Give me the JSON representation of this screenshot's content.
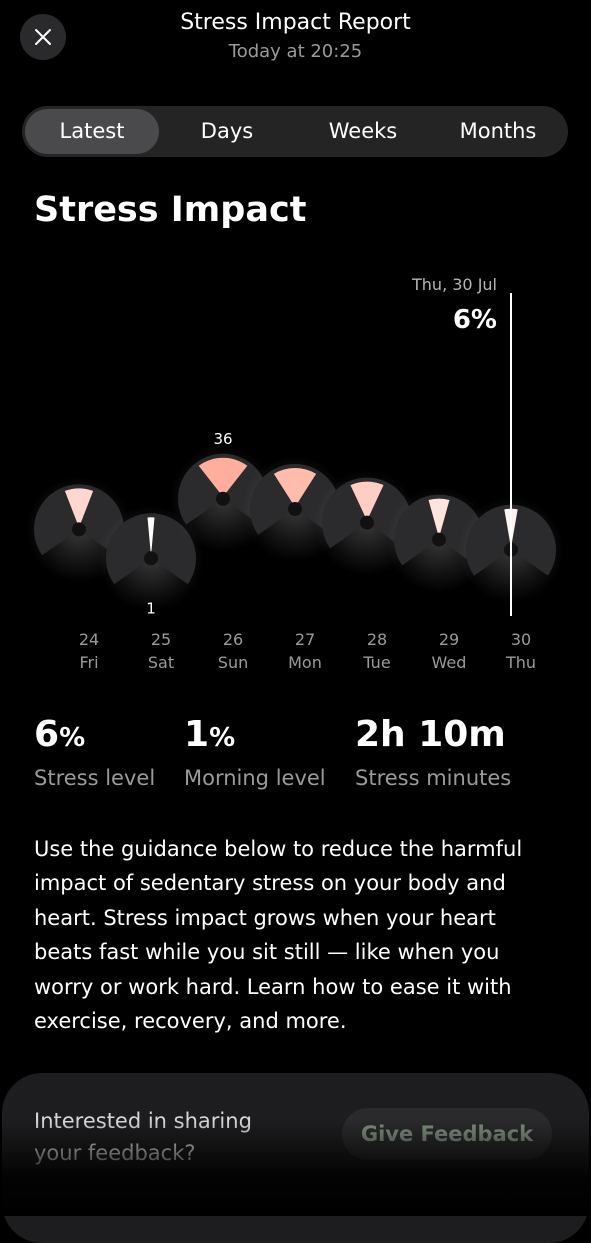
{
  "header": {
    "close_icon": "close-icon",
    "title": "Stress Impact Report",
    "subtitle": "Today at 20:25"
  },
  "tabs": [
    {
      "label": "Latest",
      "active": true
    },
    {
      "label": "Days",
      "active": false
    },
    {
      "label": "Weeks",
      "active": false
    },
    {
      "label": "Months",
      "active": false
    }
  ],
  "section_title": "Stress Impact",
  "chart_data": {
    "type": "dial",
    "selected": {
      "date": "Thu, 30 Jul",
      "value": "6%"
    },
    "days": [
      {
        "date": "24",
        "weekday": "Fri",
        "value": 18,
        "label": ""
      },
      {
        "date": "25",
        "weekday": "Sat",
        "value": 1,
        "label": "1"
      },
      {
        "date": "26",
        "weekday": "Sun",
        "value": 36,
        "label": "36"
      },
      {
        "date": "27",
        "weekday": "Mon",
        "value": 30,
        "label": ""
      },
      {
        "date": "28",
        "weekday": "Tue",
        "value": 22,
        "label": ""
      },
      {
        "date": "29",
        "weekday": "Wed",
        "value": 12,
        "label": ""
      },
      {
        "date": "30",
        "weekday": "Thu",
        "value": 6,
        "label": ""
      }
    ],
    "colors": {
      "low": "#ffffff",
      "high": "#f2a592"
    }
  },
  "stats": [
    {
      "value": "6",
      "unit": "%",
      "label": "Stress level"
    },
    {
      "value": "1",
      "unit": "%",
      "label": "Morning level"
    },
    {
      "value": "2h 10m",
      "unit": "",
      "label": "Stress minutes"
    }
  ],
  "description": "Use the guidance below to reduce the harmful impact of sedentary stress on your body and heart. Stress impact grows when your heart beats fast while you sit still — like when you worry or work hard. Learn how to ease it with exercise, recovery, and more.",
  "feedback": {
    "text": "Interested in sharing your feedback?",
    "button_label": "Give Feedback"
  }
}
